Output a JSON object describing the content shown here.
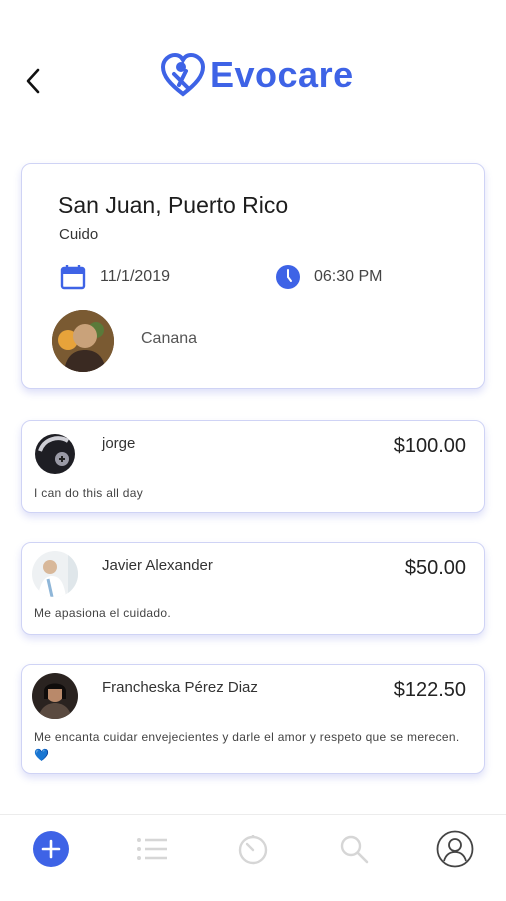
{
  "header": {
    "logo_text": "Evocare",
    "brand_color": "#3e63e6",
    "back_icon": "chevron-left-icon"
  },
  "job": {
    "location": "San Juan, Puerto Rico",
    "category": "Cuido",
    "date": "11/1/2019",
    "time": "06:30 PM",
    "person_name": "Canana",
    "calendar_icon": "calendar-icon",
    "clock_icon": "clock-icon"
  },
  "offers": [
    {
      "name": "jorge",
      "price": "$100.00",
      "message": "I can do this all day"
    },
    {
      "name": "Javier Alexander",
      "price": "$50.00",
      "message": "Me apasiona el cuidado."
    },
    {
      "name": "Francheska Pérez Diaz",
      "price": "$122.50",
      "message": "Me encanta cuidar envejecientes y darle el amor y respeto que se merecen.",
      "message_emoji": "💙"
    }
  ],
  "bottom_nav": {
    "items": [
      {
        "icon": "plus-circle-icon",
        "active": true
      },
      {
        "icon": "list-icon",
        "active": false
      },
      {
        "icon": "timer-icon",
        "active": false
      },
      {
        "icon": "search-icon",
        "active": false
      },
      {
        "icon": "profile-icon",
        "active": false
      }
    ],
    "active_color": "#3e63e6",
    "inactive_color": "#d6d6d6"
  }
}
